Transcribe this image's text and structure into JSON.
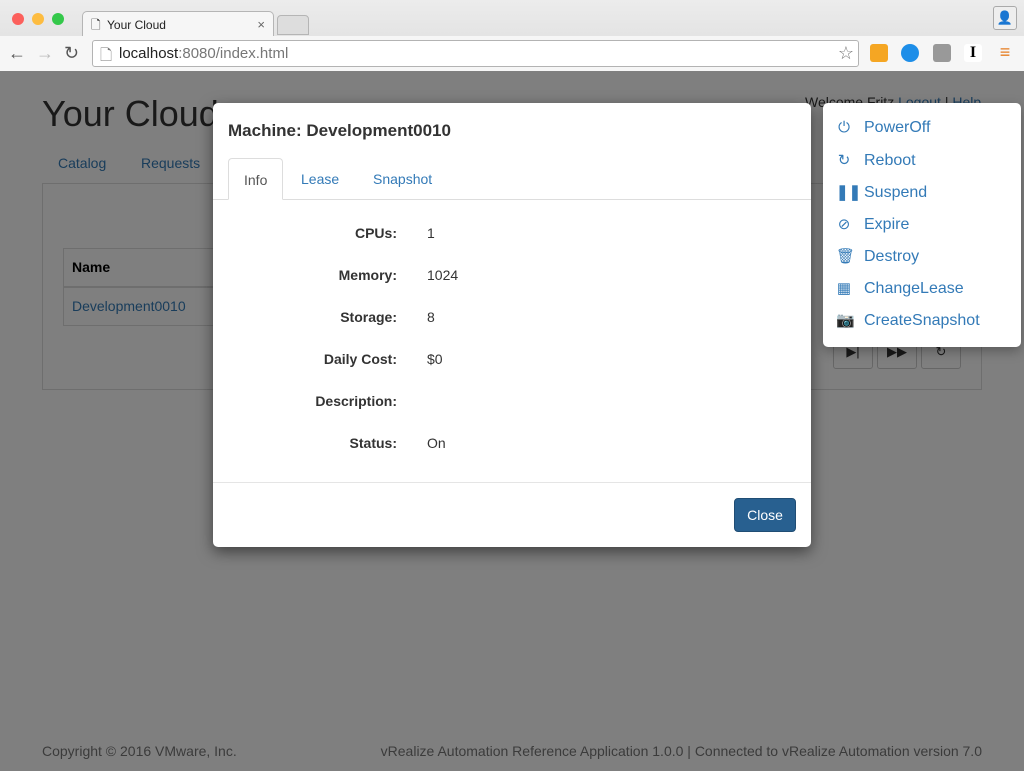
{
  "browser": {
    "tab_title": "Your Cloud",
    "url_host": "localhost",
    "url_rest": ":8080/index.html"
  },
  "page": {
    "brand": "Your Cloud",
    "welcome": "Welcome Fritz",
    "logout": "Logout",
    "help": "Help",
    "separator": "|",
    "nav": [
      "Catalog",
      "Requests"
    ],
    "table": {
      "header": "Name",
      "rows": [
        "Development0010"
      ]
    },
    "footer_left": "Copyright © 2016 VMware, Inc.",
    "footer_right": "vRealize Automation Reference Application 1.0.0 | Connected to vRealize Automation version 7.0"
  },
  "modal": {
    "title": "Machine: Development0010",
    "tabs": [
      {
        "label": "Info",
        "active": true
      },
      {
        "label": "Lease"
      },
      {
        "label": "Snapshot"
      }
    ],
    "fields": [
      {
        "label": "CPUs:",
        "value": "1"
      },
      {
        "label": "Memory:",
        "value": "1024"
      },
      {
        "label": "Storage:",
        "value": "8"
      },
      {
        "label": "Daily Cost:",
        "value": "$0"
      },
      {
        "label": "Description:",
        "value": ""
      },
      {
        "label": "Status:",
        "value": "On"
      }
    ],
    "close_label": "Close"
  },
  "menu": {
    "items": [
      {
        "label": "PowerOff",
        "icon": "power-icon"
      },
      {
        "label": "Reboot",
        "icon": "refresh-icon"
      },
      {
        "label": "Suspend",
        "icon": "pause-icon"
      },
      {
        "label": "Expire",
        "icon": "ban-icon"
      },
      {
        "label": "Destroy",
        "icon": "trash-icon"
      },
      {
        "label": "ChangeLease",
        "icon": "calendar-icon"
      },
      {
        "label": "CreateSnapshot",
        "icon": "camera-icon"
      }
    ]
  },
  "colors": {
    "link": "#337ab7",
    "primary": "#286090"
  }
}
